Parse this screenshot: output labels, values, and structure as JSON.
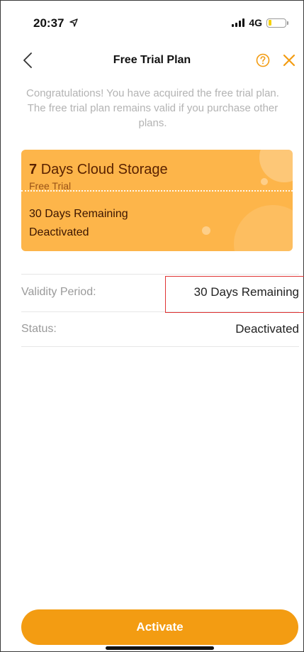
{
  "status_bar": {
    "time": "20:37",
    "location_glyph": "⟲",
    "network": "4G",
    "battery_level": 0.2
  },
  "nav": {
    "title": "Free Trial Plan",
    "back_icon": "chevron-left",
    "help_icon": "question-circle",
    "close_icon": "x-close"
  },
  "intro_text": "Congratulations! You have acquired the free trial plan. The free trial plan remains valid if you purchase other plans.",
  "card": {
    "days": "7",
    "title_rest": "Days Cloud Storage",
    "subtitle": "Free Trial",
    "remaining": "30 Days Remaining",
    "status": "Deactivated"
  },
  "details": {
    "validity_label": "Validity Period:",
    "validity_value": "30 Days Remaining",
    "status_label": "Status:",
    "status_value": "Deactivated"
  },
  "actions": {
    "activate_label": "Activate"
  },
  "colors": {
    "accent": "#f39c12",
    "card_bg": "#fdb54a",
    "highlight": "#e03434"
  }
}
